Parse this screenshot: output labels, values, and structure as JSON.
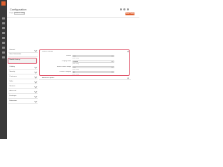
{
  "header": {
    "title": "Configuration",
    "save_label": "Save Config",
    "scope_label": "Scope:",
    "scope_value": "Default Config"
  },
  "nav": {
    "icons": [
      "dashboard-icon",
      "sales-icon",
      "catalog-icon",
      "customers-icon",
      "marketing-icon",
      "content-icon",
      "reports-icon",
      "stores-icon",
      "system-icon"
    ]
  },
  "tree": {
    "items": [
      {
        "label": "General"
      },
      {
        "label": "Store Information"
      },
      {
        "label": "Module Settings"
      },
      {
        "label": "Catalog"
      },
      {
        "label": "Security"
      },
      {
        "label": "Customers"
      },
      {
        "label": "Sales"
      },
      {
        "label": "Services"
      },
      {
        "label": "Advanced"
      },
      {
        "label": "Developer"
      },
      {
        "label": "Extensions"
      }
    ]
  },
  "panel": {
    "heading": "General Settings",
    "rows": [
      {
        "label": "Enable",
        "value": "Yes",
        "note": "[store view]"
      },
      {
        "label": "Display Mode",
        "value": "Default",
        "note": "[store view]"
      },
      {
        "label": "Show Product Image",
        "value": "Yes",
        "note": "[store view]"
      },
      {
        "label": "Default Category",
        "value": "All",
        "note": "[store view]"
      }
    ]
  },
  "section2": {
    "heading": "Advanced Options"
  },
  "colors": {
    "accent": "#e0602f",
    "highlight": "#e0556b",
    "sidebar": "#3a3a3a"
  }
}
